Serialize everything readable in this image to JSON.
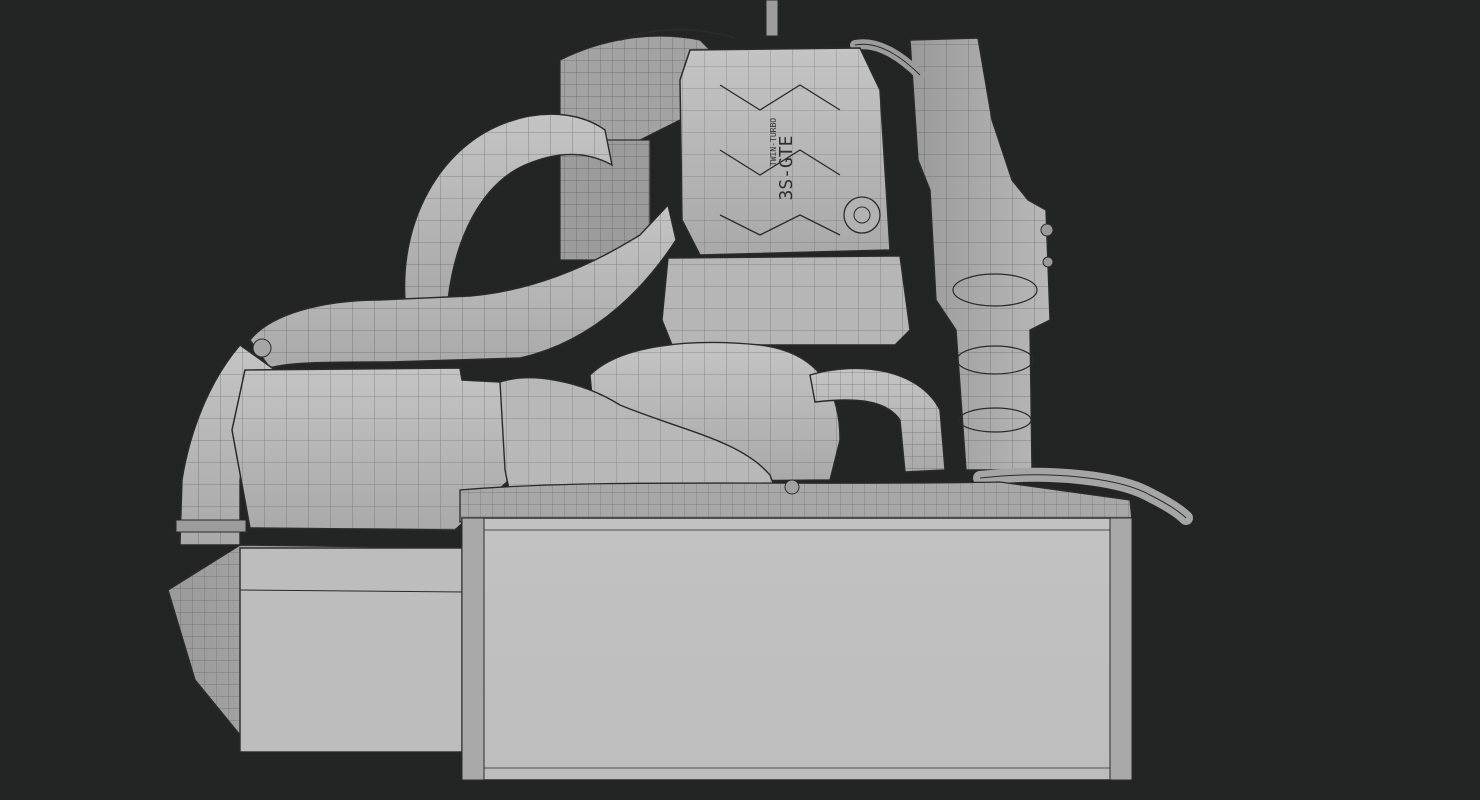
{
  "image": {
    "subject": "engine-wireframe-render",
    "colors": {
      "background": "#232524",
      "surface_light": "#b9b9b9",
      "surface_mid": "#a6a6a6",
      "surface_dark": "#8e8e8e",
      "wire": "#2a2a2a"
    }
  },
  "cam_cover": {
    "text_model": "3S-GTE",
    "text_badge": "TWIN-TURBO"
  }
}
